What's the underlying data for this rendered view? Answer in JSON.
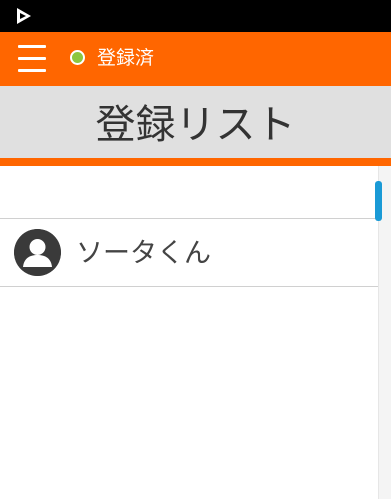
{
  "status_bar": {
    "app_icon": "play-store-notification-icon"
  },
  "toolbar": {
    "menu_icon": "hamburger-menu-icon",
    "status_dot_color": "#8dc63f",
    "status_label": "登録済",
    "background_color": "#ff6600"
  },
  "title_bar": {
    "title": "登録リスト",
    "background_color": "#e0e0e0",
    "underline_color": "#ff6600"
  },
  "list": {
    "items": [
      {
        "avatar_icon": "person-avatar-icon",
        "name": "ソータくん"
      }
    ],
    "scrollbar_color": "#1a9ad6"
  }
}
